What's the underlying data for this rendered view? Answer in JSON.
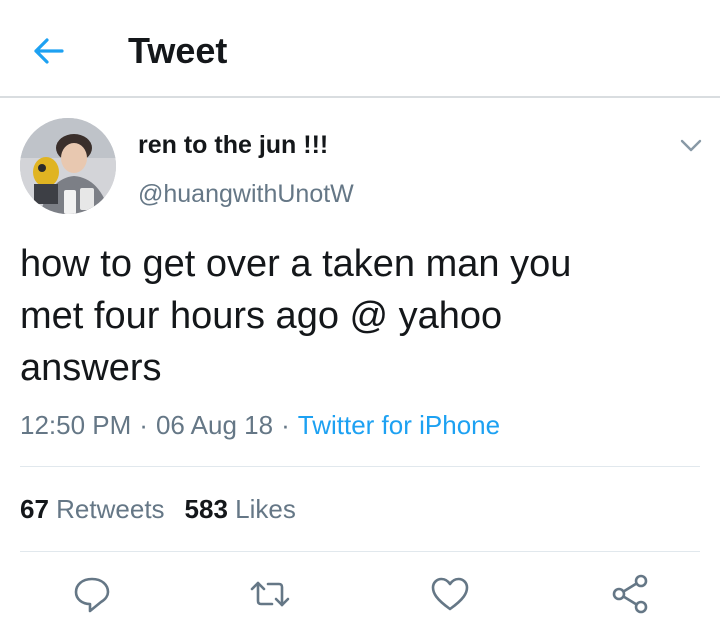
{
  "header": {
    "title": "Tweet",
    "back_icon": "arrow-left-icon"
  },
  "tweet": {
    "author": {
      "display_name": "ren to the jun !!!",
      "handle": "@huangwithUnotW"
    },
    "text_lines": [
      "how to get over a taken man you",
      "met four hours ago @ yahoo",
      "answers"
    ],
    "time": "12:50 PM",
    "separator": "·",
    "date": "06 Aug 18",
    "source": "Twitter for iPhone",
    "stats": {
      "retweets_count": "67",
      "retweets_label": "Retweets",
      "likes_count": "583",
      "likes_label": "Likes"
    }
  },
  "actions": [
    "reply-icon",
    "retweet-icon",
    "like-icon",
    "share-icon"
  ],
  "colors": {
    "accent": "#1da1f2",
    "text": "#14171a",
    "secondary": "#657786",
    "divider": "#e1e8ed"
  }
}
